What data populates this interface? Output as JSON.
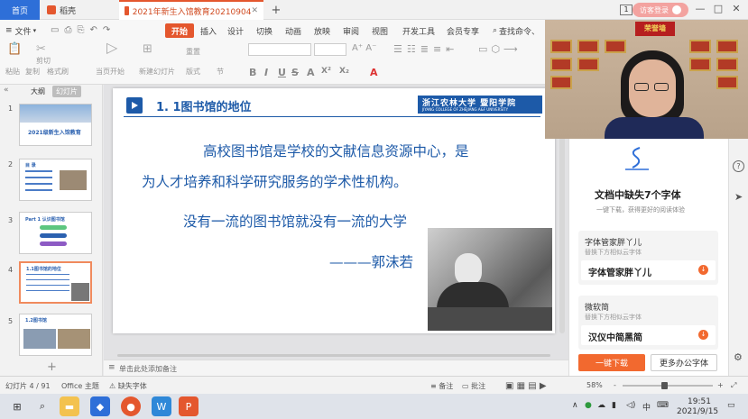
{
  "tabs": {
    "home": "首页",
    "doke": "稻壳",
    "doc": "2021年新生入馆教育20210904",
    "add": "+"
  },
  "titlebar": {
    "window_count": "1",
    "login": "访客登录",
    "minimize": "—",
    "maximize": "□",
    "close": "✕"
  },
  "ribbon": {
    "file_menu": "文件",
    "menus": [
      "开始",
      "插入",
      "设计",
      "切换",
      "动画",
      "放映",
      "审阅",
      "视图",
      "开发工具",
      "会员专享"
    ],
    "search": "查找命令、",
    "row2": [
      "粘贴",
      "剪切",
      "复制",
      "格式刷",
      "当页开始",
      "新建幻灯片",
      "版式",
      "节",
      "重置"
    ],
    "format_buttons": [
      "B",
      "I",
      "U",
      "S",
      "A",
      "X²",
      "X₂",
      "A"
    ]
  },
  "left_panel": {
    "tab_outline": "大纲",
    "tab_slides": "幻灯片",
    "slide_numbers": [
      "1",
      "2",
      "3",
      "4",
      "5"
    ],
    "thumb1_title": "2021级新生入馆教育",
    "thumb2_title": "目 录",
    "thumb3_title": "Part 1 认识图书馆",
    "thumb4_title": "1.1图书馆的地位",
    "thumb5_title": "1.2图书馆"
  },
  "slide": {
    "title": "1. 1图书馆的地位",
    "logo_cn": "浙江农林大学 暨阳学院",
    "logo_en": "JIYANG COLLEGE OF ZHEJIANG A&F UNIVERSITY",
    "line1": "高校图书馆是学校的文献信息资源中心，是",
    "line2": "为人才培养和科学研究服务的学术性机构。",
    "quote": "没有一流的图书馆就没有一流的大学",
    "author": "———郭沫若"
  },
  "notes": {
    "placeholder": "单击此处添加备注"
  },
  "video": {
    "honor_wall": "荣誉墙"
  },
  "right_panel": {
    "missing_title": "文档中缺失7个字体",
    "missing_sub": "一键下载，获得更好的阅读体验",
    "fonts": [
      {
        "name": "字体管家胖丫儿",
        "sub": "替换下方相似云字体",
        "replacement": "字体管家胖丫儿"
      },
      {
        "name": "微软简",
        "sub": "替换下方相似云字体",
        "replacement": "汉仪中简黑简"
      }
    ],
    "download_btn": "一键下载",
    "more_btn": "更多办公字体"
  },
  "statusbar": {
    "slide_info": "幻灯片 4 / 91",
    "theme": "Office 主题",
    "missing_font": "缺失字体",
    "notes": "备注",
    "comments": "批注",
    "zoom": "58%",
    "minus": "-",
    "plus": "+"
  },
  "taskbar": {
    "time": "19:51",
    "date": "2021/9/15",
    "ime": "中"
  },
  "colors": {
    "accent": "#e4572e",
    "slide_blue": "#1d5aa8",
    "download_orange": "#f2692f"
  }
}
